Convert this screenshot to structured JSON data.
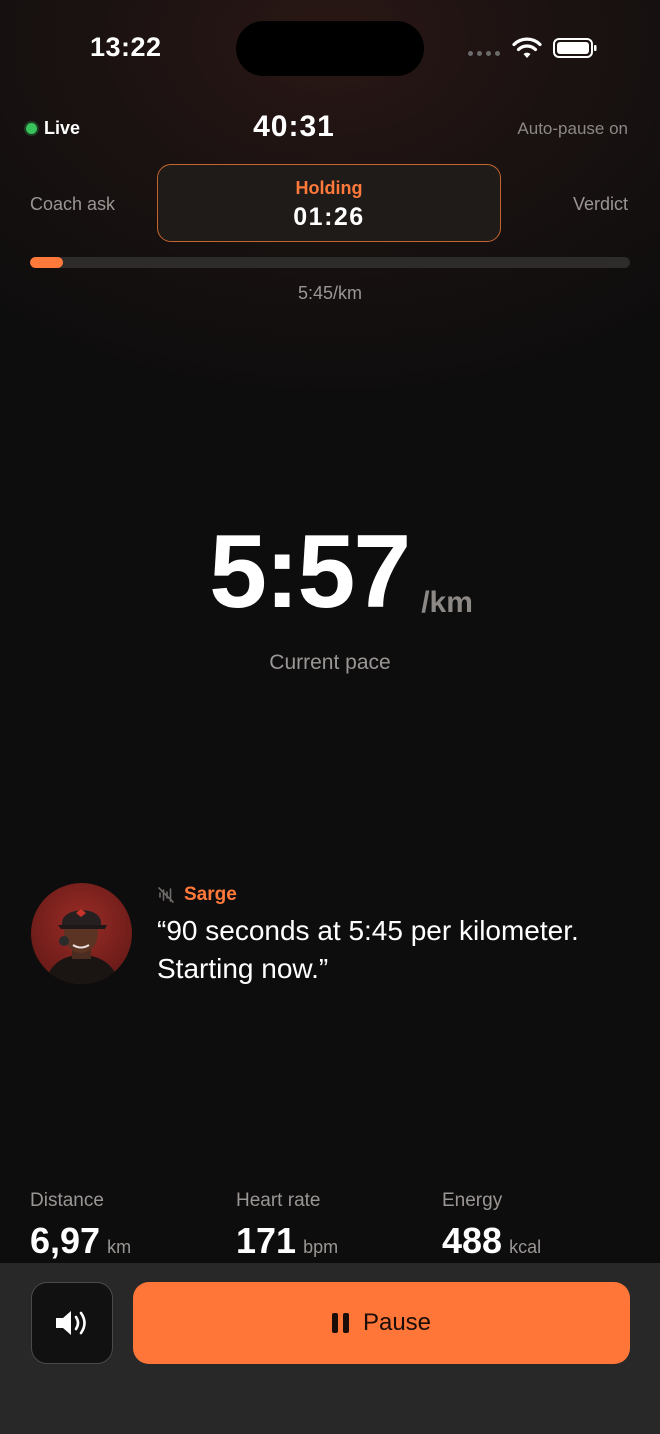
{
  "status_bar": {
    "time": "13:22"
  },
  "header": {
    "live_label": "Live",
    "elapsed": "40:31",
    "auto_pause": "Auto-pause on"
  },
  "stages": {
    "previous": "Coach ask",
    "current_label": "Holding",
    "current_time": "01:26",
    "next": "Verdict"
  },
  "progress": {
    "fraction": 0.055,
    "target_pace": "5:45/km"
  },
  "pace": {
    "value": "5:57",
    "unit": "/km",
    "label": "Current pace"
  },
  "coach": {
    "name": "Sarge",
    "quote": "“90 seconds at 5:45 per kilometer. Starting now.”"
  },
  "metrics": [
    {
      "label": "Distance",
      "value": "6,97",
      "unit": "km"
    },
    {
      "label": "Heart rate",
      "value": "171",
      "unit": "bpm"
    },
    {
      "label": "Energy",
      "value": "488",
      "unit": "kcal"
    }
  ],
  "controls": {
    "pause_label": "Pause"
  },
  "colors": {
    "accent": "#ff7638",
    "live": "#37c25b",
    "background": "#0e0d0d"
  },
  "icons": [
    "wifi-icon",
    "battery-icon",
    "voice-muted-icon",
    "speaker-icon",
    "pause-icon"
  ]
}
